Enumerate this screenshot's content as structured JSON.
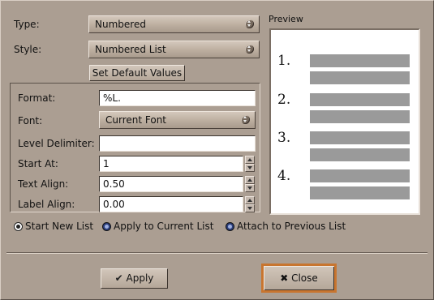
{
  "type_label": "Type:",
  "type_value": "Numbered",
  "style_label": "Style:",
  "style_value": "Numbered List",
  "set_default_button": "Set Default Values",
  "format_label": "Format:",
  "format_value": "%L.",
  "font_label": "Font:",
  "font_value": "Current Font",
  "level_delimiter_label": "Level Delimiter:",
  "level_delimiter_value": "",
  "start_at_label": "Start At:",
  "start_at_value": "1",
  "text_align_label": "Text Align:",
  "text_align_value": "0.50",
  "label_align_label": "Label Align:",
  "label_align_value": "0.00",
  "radio_options": [
    {
      "label": "Start New List",
      "selected": true
    },
    {
      "label": "Apply to Current List",
      "selected": false
    },
    {
      "label": "Attach to Previous List",
      "selected": false
    }
  ],
  "preview_label": "Preview",
  "preview_numbers": [
    "1.",
    "2.",
    "3.",
    "4."
  ],
  "apply_button": "Apply",
  "close_button": "Close",
  "colors": {
    "background": "#ab9e92",
    "close_border": "#c8752f",
    "preview_bar": "#9a9a9a"
  }
}
